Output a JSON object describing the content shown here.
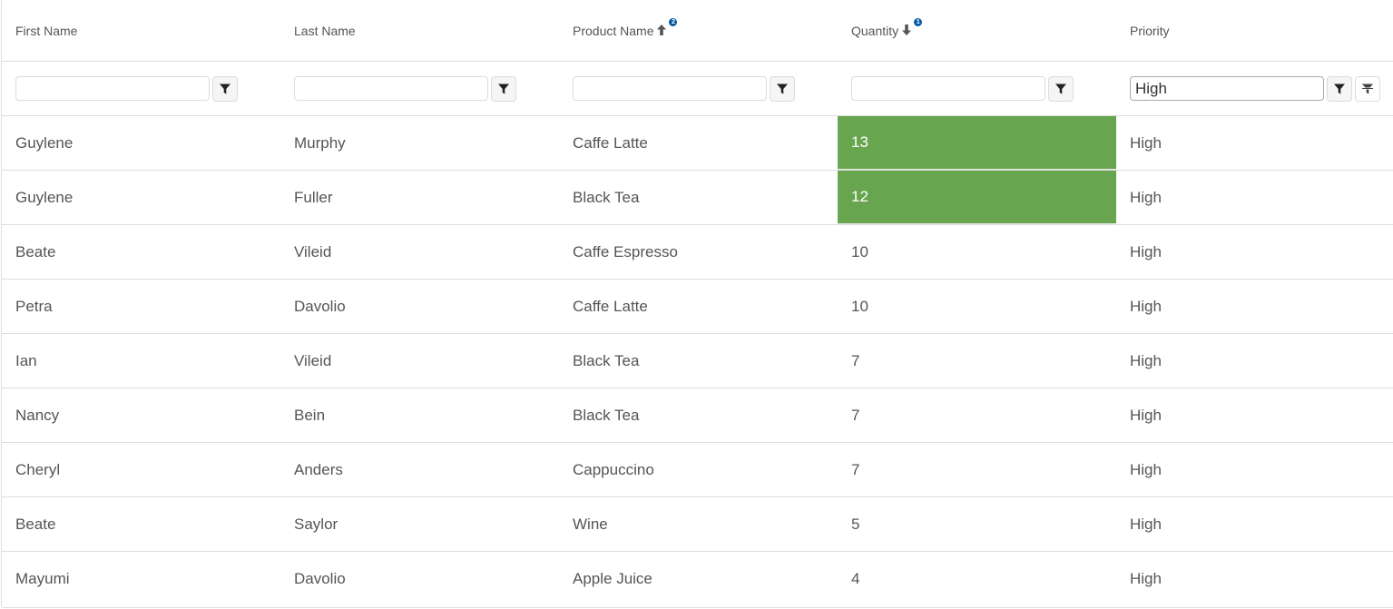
{
  "colors": {
    "highlight_bg": "#67a64f",
    "sort_badge": "#055aa6",
    "border": "#dddddd",
    "text": "#555555"
  },
  "columns": [
    {
      "label": "First Name",
      "sort": null,
      "sort_order": null
    },
    {
      "label": "Last Name",
      "sort": null,
      "sort_order": null
    },
    {
      "label": "Product Name",
      "sort": "asc",
      "sort_order": "2"
    },
    {
      "label": "Quantity",
      "sort": "desc",
      "sort_order": "1"
    },
    {
      "label": "Priority",
      "sort": null,
      "sort_order": null
    }
  ],
  "filters": [
    {
      "value": "",
      "icon": "filter-icon"
    },
    {
      "value": "",
      "icon": "filter-icon"
    },
    {
      "value": "",
      "icon": "filter-icon"
    },
    {
      "value": "",
      "icon": "filter-icon"
    },
    {
      "value": "High",
      "icon": "filter-icon",
      "clear_icon": "clear-filter-icon"
    }
  ],
  "rows": [
    {
      "first": "Guylene",
      "last": "Murphy",
      "product": "Caffe Latte",
      "quantity": "13",
      "priority": "High",
      "highlight": true
    },
    {
      "first": "Guylene",
      "last": "Fuller",
      "product": "Black Tea",
      "quantity": "12",
      "priority": "High",
      "highlight": true
    },
    {
      "first": "Beate",
      "last": "Vileid",
      "product": "Caffe Espresso",
      "quantity": "10",
      "priority": "High",
      "highlight": false
    },
    {
      "first": "Petra",
      "last": "Davolio",
      "product": "Caffe Latte",
      "quantity": "10",
      "priority": "High",
      "highlight": false
    },
    {
      "first": "Ian",
      "last": "Vileid",
      "product": "Black Tea",
      "quantity": "7",
      "priority": "High",
      "highlight": false
    },
    {
      "first": "Nancy",
      "last": "Bein",
      "product": "Black Tea",
      "quantity": "7",
      "priority": "High",
      "highlight": false
    },
    {
      "first": "Cheryl",
      "last": "Anders",
      "product": "Cappuccino",
      "quantity": "7",
      "priority": "High",
      "highlight": false
    },
    {
      "first": "Beate",
      "last": "Saylor",
      "product": "Wine",
      "quantity": "5",
      "priority": "High",
      "highlight": false
    },
    {
      "first": "Mayumi",
      "last": "Davolio",
      "product": "Apple Juice",
      "quantity": "4",
      "priority": "High",
      "highlight": false
    }
  ]
}
